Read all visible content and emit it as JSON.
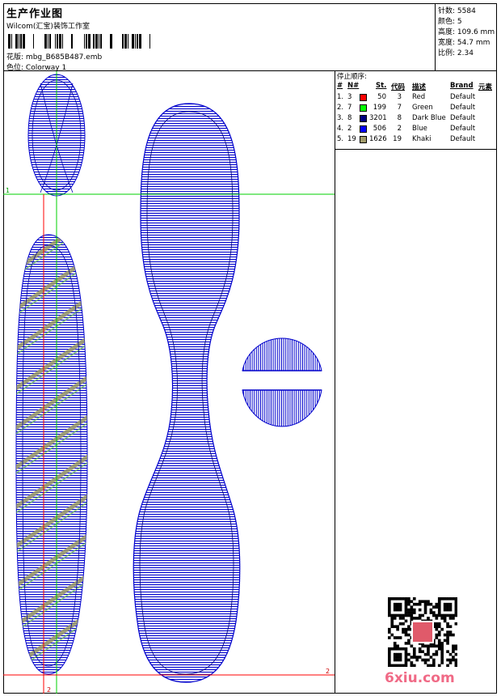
{
  "header": {
    "title": "生产作业图",
    "company": "Wilcom(汇宝)装饰工作室",
    "design_label": "花版:",
    "design_file": "mbg_B685B487.emb",
    "colorway_label": "色位:",
    "colorway": "Colorway 1"
  },
  "stats": [
    {
      "label": "针数:",
      "value": "5584"
    },
    {
      "label": "颜色:",
      "value": "5"
    },
    {
      "label": "高度:",
      "value": "109.6 mm"
    },
    {
      "label": "宽度:",
      "value": "54.7 mm"
    },
    {
      "label": "比例:",
      "value": "2.34"
    }
  ],
  "stop_sequence": {
    "caption": "停止顺序:",
    "headers": {
      "idx": "#",
      "n": "N#",
      "st": "St.",
      "code": "代码",
      "desc": "描述",
      "brand": "Brand",
      "element": "元素"
    },
    "rows": [
      {
        "idx": "1.",
        "n": "3",
        "color": "#ff0000",
        "st": "50",
        "code": "3",
        "desc": "Red",
        "brand": "Default"
      },
      {
        "idx": "2.",
        "n": "7",
        "color": "#00ff00",
        "st": "199",
        "code": "7",
        "desc": "Green",
        "brand": "Default"
      },
      {
        "idx": "3.",
        "n": "8",
        "color": "#00007f",
        "st": "3201",
        "code": "8",
        "desc": "Dark Blue",
        "brand": "Default"
      },
      {
        "idx": "4.",
        "n": "2",
        "color": "#0000ff",
        "st": "506",
        "code": "2",
        "desc": "Blue",
        "brand": "Default"
      },
      {
        "idx": "5.",
        "n": "19",
        "color": "#a09a6a",
        "st": "1626",
        "code": "19",
        "desc": "Khaki",
        "brand": "Default"
      }
    ]
  },
  "canvas": {
    "guide_h_label": "1",
    "guide_v_label": "2",
    "guide_corner_label": "2"
  },
  "watermark": "6xiu.com",
  "colors": {
    "guide_red": "#ff0000",
    "guide_green": "#00d000",
    "thread_blue": "#0000cc"
  }
}
